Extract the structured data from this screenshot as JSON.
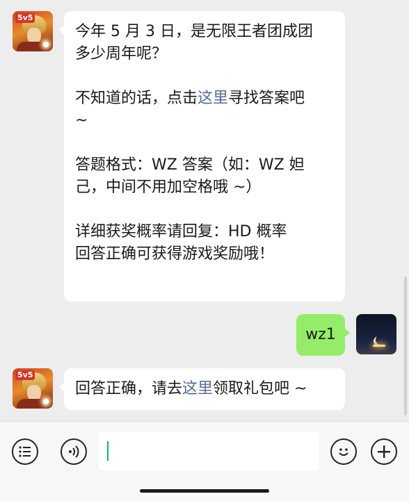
{
  "messages": {
    "first": {
      "line1": "今年 5 月 3 日，是无限王者团成团",
      "line2": "多少周年呢？",
      "hint_prefix": "不知道的话，点击",
      "hint_link": "这里",
      "hint_suffix": "寻找答案吧",
      "hint_tail": "~",
      "format_line1": "答题格式：WZ 答案（如：WZ 妲",
      "format_line2": "己，中间不用加空格哦 ~）",
      "detail_line1": "详细获奖概率请回复：HD 概率",
      "detail_line2": "回答正确可获得游戏奖励哦！"
    },
    "reply": {
      "text": "wz1"
    },
    "second": {
      "prefix": "回答正确，请去",
      "link": "这里",
      "suffix": "领取礼包吧 ~"
    }
  },
  "avatars": {
    "game_badge": "5v5"
  },
  "toolbar": {
    "list_icon": "list-icon",
    "voice_icon": "voice-icon",
    "emoji_icon": "emoji-icon",
    "plus_icon": "plus-icon"
  },
  "colors": {
    "link": "#576b95",
    "sent_bubble": "#95ec69",
    "background": "#ededed"
  }
}
